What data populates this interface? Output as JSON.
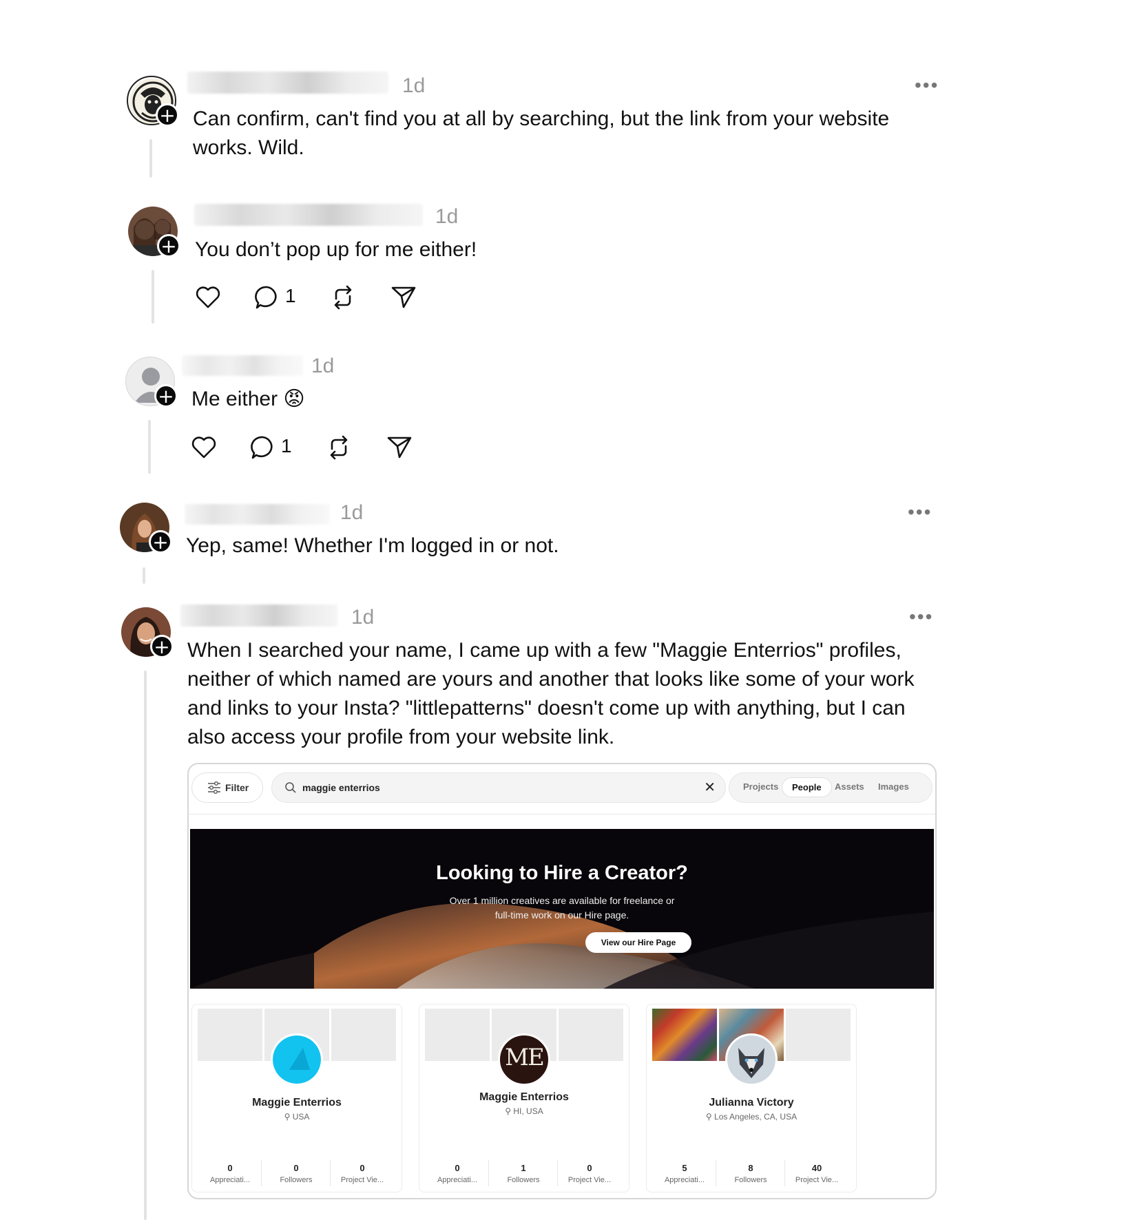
{
  "posts": [
    {
      "time": "1d",
      "text": "Can confirm, can't find you at all by searching, but the link from your website works. Wild.",
      "more": "•••"
    },
    {
      "time": "1d",
      "text": "You don’t pop up for me either!",
      "likes": "",
      "replies": "1"
    },
    {
      "time": "1d",
      "text": "Me either 😡",
      "replies": "1"
    },
    {
      "time": "1d",
      "text": "Yep, same! Whether I'm logged in or not.",
      "more": "•••"
    },
    {
      "time": "1d",
      "text": "When I searched your name, I came up with a few \"Maggie Enterrios\" profiles, neither of which named are yours and another that looks like some of your work and links to your Insta? \"littlepatterns\" doesn't come up with anything, but I can also access your profile from your website link.",
      "more": "•••"
    }
  ],
  "screenshot": {
    "filter_label": "Filter",
    "search_value": "maggie enterrios",
    "clear": "✕",
    "tabs": [
      "Projects",
      "People",
      "Assets",
      "Images"
    ],
    "active_tab": "People",
    "banner": {
      "title": "Looking to Hire a Creator?",
      "subtitle_line1": "Over 1 million creatives are available for freelance or",
      "subtitle_line2": "full-time work on our Hire page.",
      "button": "View our Hire Page"
    },
    "profiles": [
      {
        "name": "Maggie Enterrios",
        "location": "USA",
        "stats": [
          {
            "value": "0",
            "label": "Appreciati..."
          },
          {
            "value": "0",
            "label": "Followers"
          },
          {
            "value": "0",
            "label": "Project Vie..."
          }
        ]
      },
      {
        "name": "Maggie Enterrios",
        "location": "HI, USA",
        "avatar_text": "ME",
        "stats": [
          {
            "value": "0",
            "label": "Appreciati..."
          },
          {
            "value": "1",
            "label": "Followers"
          },
          {
            "value": "0",
            "label": "Project Vie..."
          }
        ]
      },
      {
        "name": "Julianna Victory",
        "location": "Los Angeles, CA, USA",
        "stats": [
          {
            "value": "5",
            "label": "Appreciati..."
          },
          {
            "value": "8",
            "label": "Followers"
          },
          {
            "value": "40",
            "label": "Project Vie..."
          }
        ]
      }
    ]
  },
  "colors": {
    "text": "#111111",
    "muted": "#9a9a9a",
    "thread_line": "#e3e3e3",
    "accent_cyan": "#12c3f0"
  }
}
